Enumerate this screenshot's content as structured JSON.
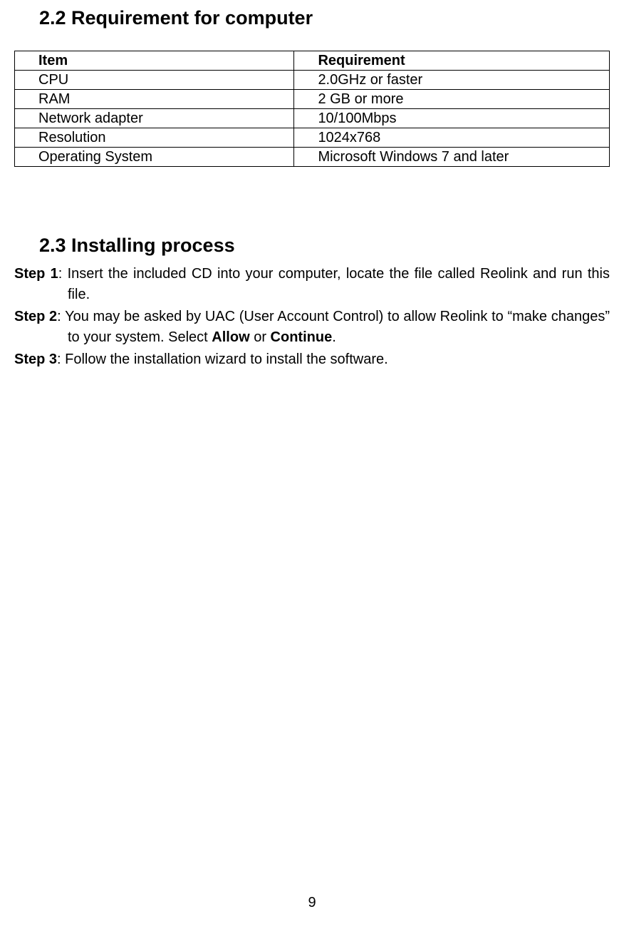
{
  "section22": {
    "title": "2.2 Requirement for computer"
  },
  "table": {
    "header": {
      "item": "Item",
      "req": "Requirement"
    },
    "rows": [
      {
        "item": "CPU",
        "req": "2.0GHz or faster"
      },
      {
        "item": "RAM",
        "req": "2 GB or more"
      },
      {
        "item": "Network adapter",
        "req": "10/100Mbps"
      },
      {
        "item": "Resolution",
        "req": "1024x768"
      },
      {
        "item": "Operating System",
        "req": "Microsoft Windows 7 and later"
      }
    ]
  },
  "section23": {
    "title": "2.3 Installing process"
  },
  "steps": {
    "s1": {
      "label": "Step 1",
      "text": ": Insert the included CD into your computer, locate the file called Reolink and run this file."
    },
    "s2": {
      "label": "Step 2",
      "part1": ": You may be asked by UAC (User Account Control) to allow Reolink to “make changes” to your system. Select ",
      "allow": "Allow",
      "or": " or ",
      "continue": "Continue",
      "end": "."
    },
    "s3": {
      "label": "Step 3",
      "text": ": Follow the installation wizard to install the software."
    }
  },
  "page_number": "9"
}
